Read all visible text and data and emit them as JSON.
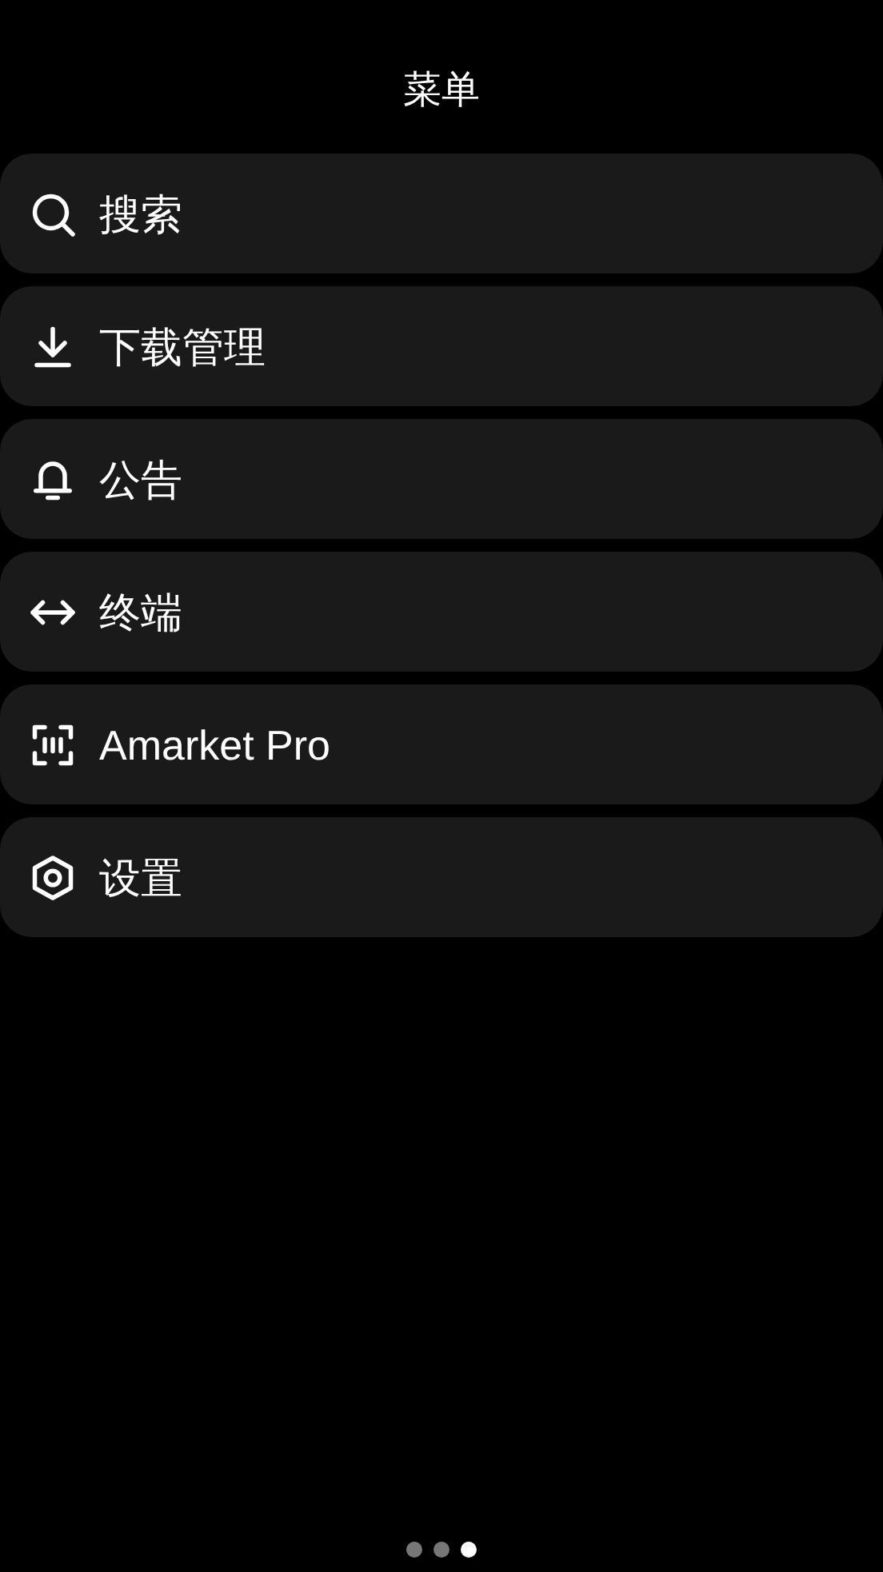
{
  "title": "菜单",
  "items": [
    {
      "kind": "search",
      "label": "搜索"
    },
    {
      "kind": "download",
      "label": "下载管理"
    },
    {
      "kind": "bell",
      "label": "公告"
    },
    {
      "kind": "code",
      "label": "终端"
    },
    {
      "kind": "scan",
      "label": "Amarket Pro"
    },
    {
      "kind": "settings",
      "label": "设置"
    }
  ],
  "pager": [
    {
      "selected": false
    },
    {
      "selected": false
    },
    {
      "selected": true
    }
  ]
}
